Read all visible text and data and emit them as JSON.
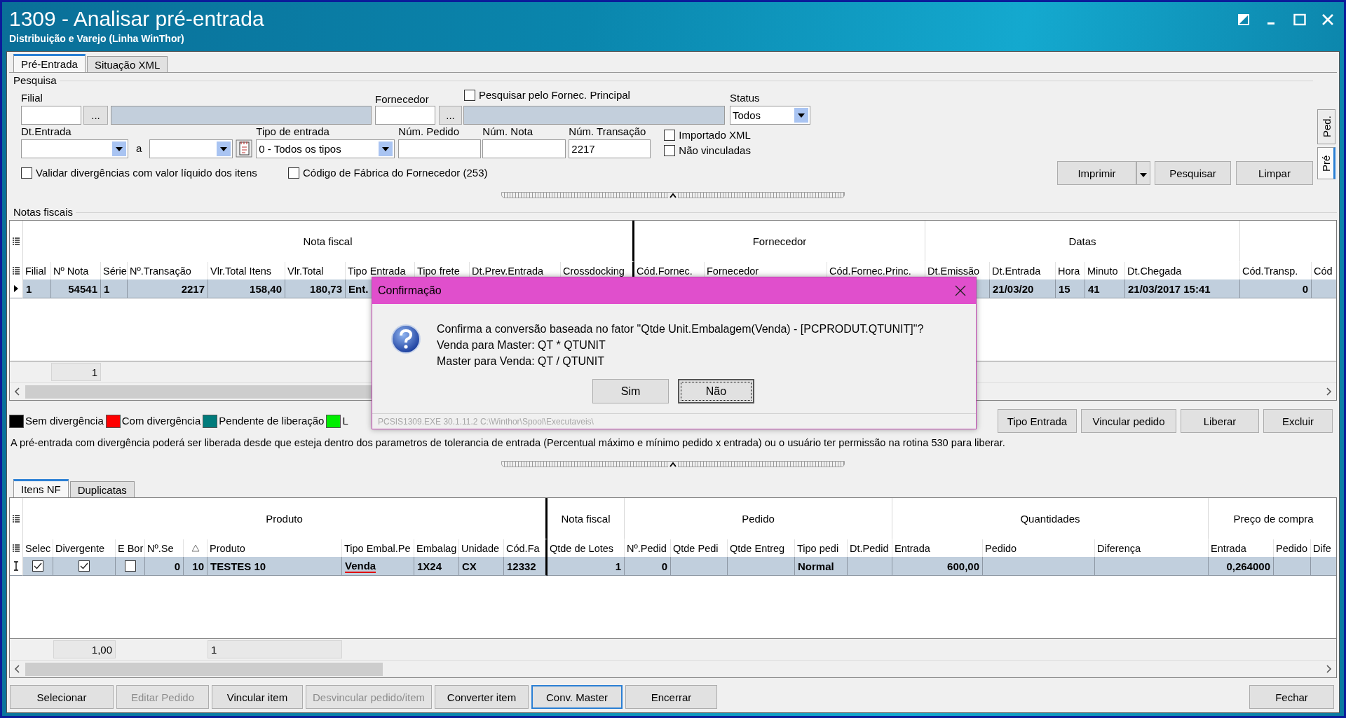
{
  "window": {
    "title": "1309 - Analisar pré-entrada",
    "subtitle": "Distribuição e Varejo (Linha WinThor)"
  },
  "main_tabs": [
    {
      "label": "Pré-Entrada",
      "selected": true
    },
    {
      "label": "Situação XML",
      "selected": false
    }
  ],
  "side_tabs": [
    {
      "label": "Ped.",
      "selected": false
    },
    {
      "label": "Pré",
      "selected": true
    }
  ],
  "search": {
    "title": "Pesquisa",
    "filial": {
      "label": "Filial",
      "button": "..."
    },
    "fornecedor": {
      "label": "Fornecedor",
      "button": "..."
    },
    "fornec_principal": {
      "label": "Pesquisar pelo Fornec. Principal",
      "checked": false
    },
    "status": {
      "label": "Status",
      "value": "Todos"
    },
    "dt_entrada": {
      "label": "Dt.Entrada",
      "separator": "a"
    },
    "tipo_entrada": {
      "label": "Tipo de entrada",
      "value": "0 - Todos os tipos"
    },
    "num_pedido": {
      "label": "Núm. Pedido"
    },
    "num_nota": {
      "label": "Núm. Nota"
    },
    "num_transacao": {
      "label": "Núm. Transação",
      "value": "2217"
    },
    "options": [
      {
        "label": "Importado XML",
        "checked": false
      },
      {
        "label": "Não vinculadas",
        "checked": false
      }
    ],
    "options_bottom": [
      {
        "label": "Validar divergências com valor líquido dos itens",
        "checked": false
      },
      {
        "label": "Código de Fábrica do Fornecedor (253)",
        "checked": false
      }
    ],
    "buttons": [
      "Imprimir",
      "Pesquisar",
      "Limpar"
    ]
  },
  "notas": {
    "title": "Notas fiscais",
    "groups": [
      {
        "label": "Nota fiscal",
        "columns": [
          {
            "label": "Filial"
          },
          {
            "label": "Nº Nota"
          },
          {
            "label": "Série"
          },
          {
            "label": "Nº.Transação"
          },
          {
            "label": "Vlr.Total Itens"
          },
          {
            "label": "Vlr.Total"
          },
          {
            "label": "Tipo Entrada"
          },
          {
            "label": "Tipo frete"
          },
          {
            "label": "Dt.Prev.Entrada"
          },
          {
            "label": "Crossdocking"
          }
        ]
      },
      {
        "label": "Fornecedor",
        "columns": [
          {
            "label": "Cód.Fornec."
          },
          {
            "label": "Fornecedor"
          },
          {
            "label": "Cód.Fornec.Princ."
          }
        ]
      },
      {
        "label": "Datas",
        "columns": [
          {
            "label": "Dt.Emissão"
          },
          {
            "label": "Dt.Entrada"
          },
          {
            "label": "Hora"
          },
          {
            "label": "Minuto"
          },
          {
            "label": "Dt.Chegada"
          }
        ]
      },
      {
        "columns": [
          {
            "label": "Cód.Transp."
          },
          {
            "label": "Cód"
          }
        ]
      }
    ],
    "rows": [
      {
        "selected": true,
        "cells": {
          "c0": "1",
          "c1": "54541",
          "c2": "1",
          "c3": "2217",
          "c4": "158,40",
          "c5": "180,73",
          "c6": "Ent.",
          "c14": "21/03/20",
          "c15": "15",
          "c16": "41",
          "c17": "21/03/2017 15:41",
          "c18": "0"
        }
      }
    ],
    "footer": {
      "c1": "1"
    },
    "legend": [
      {
        "label": "Sem divergência",
        "color": "#000000"
      },
      {
        "label": "Com divergência",
        "color": "#ff0000"
      },
      {
        "label": "Pendente de liberação",
        "color": "#007b7b"
      },
      {
        "label": "L",
        "color": "#00ee00"
      }
    ],
    "actions": [
      "Tipo Entrada",
      "Vincular pedido",
      "Liberar",
      "Excluir"
    ],
    "note": "A pré-entrada com divergência poderá ser liberada desde que esteja dentro dos parametros de tolerancia de entrada (Percentual máximo e mínimo pedido x entrada) ou o usuário ter permissão na rotina 530 para liberar."
  },
  "itens": {
    "tabs": [
      {
        "label": "Itens NF",
        "selected": true
      },
      {
        "label": "Duplicatas",
        "selected": false
      }
    ],
    "groups": [
      {
        "label": "Produto",
        "columns": [
          {
            "label": "Selec"
          },
          {
            "label": "Divergente"
          },
          {
            "label": "E Bor"
          },
          {
            "label": "Nº.Se"
          },
          {
            "sorted": true
          },
          {
            "label": "Produto"
          },
          {
            "label": "Tipo Embal.Pe"
          },
          {
            "label": "Embalag"
          },
          {
            "label": "Unidade"
          },
          {
            "label": "Cód.Fa"
          }
        ]
      },
      {
        "label": "Nota fiscal",
        "columns": [
          {
            "label": "Qtde de Lotes"
          }
        ]
      },
      {
        "label": "Pedido",
        "columns": [
          {
            "label": "Nº.Pedid"
          },
          {
            "label": "Qtde Pedi"
          },
          {
            "label": "Qtde Entreg"
          },
          {
            "label": "Tipo pedi"
          },
          {
            "label": "Dt.Pedid"
          }
        ]
      },
      {
        "label": "Quantidades",
        "columns": [
          {
            "label": "Entrada"
          },
          {
            "label": "Pedido"
          },
          {
            "label": "Diferença"
          }
        ]
      },
      {
        "label": "Preço de compra",
        "columns": [
          {
            "label": "Entrada"
          },
          {
            "label": "Pedido"
          },
          {
            "label": "Dife"
          }
        ]
      }
    ],
    "rows": [
      {
        "selected": true,
        "cells": {
          "c0": {
            "kind": "checkbox",
            "checked": true
          },
          "c1": {
            "kind": "checkbox",
            "checked": true
          },
          "c2": {
            "kind": "checkbox",
            "checked": false
          },
          "c3": "0",
          "c4": "10",
          "c5": "TESTES 10",
          "c6": {
            "kind": "text",
            "text": "Venda",
            "marked": true
          },
          "c7": "1X24",
          "c8": "CX",
          "c9": "12332",
          "c10": "1",
          "c11": "0",
          "c14": "Normal",
          "c16": "600,00",
          "c19": "0,264000"
        }
      }
    ],
    "footer": {
      "c1": "1,00",
      "c5": "1"
    }
  },
  "bottom_buttons": [
    {
      "label": "Selecionar",
      "disabled": false,
      "focused": false
    },
    {
      "label": "Editar Pedido",
      "disabled": true,
      "focused": false
    },
    {
      "label": "Vincular item",
      "disabled": false,
      "focused": false
    },
    {
      "label": "Desvincular pedido/item",
      "disabled": true,
      "focused": false
    },
    {
      "label": "Converter item",
      "disabled": false,
      "focused": false
    },
    {
      "label": "Conv. Master",
      "disabled": false,
      "focused": true
    },
    {
      "label": "Encerrar",
      "disabled": false,
      "focused": false
    }
  ],
  "close_button": "Fechar",
  "dialog": {
    "title": "Confirmação",
    "lines": [
      "Confirma a conversão baseada no fator \"Qtde Unit.Embalagem(Venda) - [PCPRODUT.QTUNIT]\"?",
      "Venda para Master: QT * QTUNIT",
      "Master para Venda: QT / QTUNIT"
    ],
    "buttons": [
      {
        "label": "Sim",
        "focused": false
      },
      {
        "label": "Não",
        "focused": true
      }
    ],
    "status": "PCSIS1309.EXE 30.1.11.2 C:\\Winthor\\Spool\\Executaveis\\"
  }
}
